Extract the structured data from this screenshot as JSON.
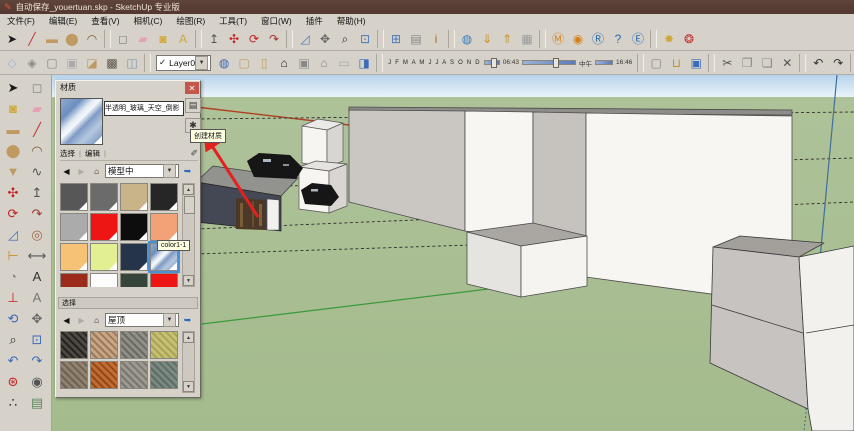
{
  "window": {
    "title": "自动保存_youertuan.skp - SketchUp 专业版"
  },
  "menu": {
    "items": [
      {
        "name": "file",
        "label": "文件(F)"
      },
      {
        "name": "edit",
        "label": "编辑(E)"
      },
      {
        "name": "view",
        "label": "查看(V)"
      },
      {
        "name": "camera",
        "label": "相机(C)"
      },
      {
        "name": "draw",
        "label": "绘图(R)"
      },
      {
        "name": "tools",
        "label": "工具(T)"
      },
      {
        "name": "window",
        "label": "窗口(W)"
      },
      {
        "name": "plugins",
        "label": "插件"
      },
      {
        "name": "help",
        "label": "帮助(H)"
      }
    ]
  },
  "toolbars": {
    "top": {
      "icons": [
        {
          "name": "select",
          "glyph": "➤",
          "color": "#1a1a1a"
        },
        {
          "name": "line",
          "glyph": "╱",
          "color": "#c03030"
        },
        {
          "name": "rectangle",
          "glyph": "▬",
          "color": "#bf9a63"
        },
        {
          "name": "circle",
          "glyph": "⬤",
          "color": "#bf9a63"
        },
        {
          "name": "arc",
          "glyph": "◠",
          "color": "#7a5a32"
        },
        {
          "sep": true
        },
        {
          "name": "make-component",
          "glyph": "◻",
          "color": "#8a8a8a"
        },
        {
          "name": "eraser",
          "glyph": "▰",
          "color": "#e8a0b6"
        },
        {
          "name": "paint-bucket",
          "glyph": "◙",
          "color": "#d0a83a"
        },
        {
          "name": "text",
          "glyph": "A",
          "color": "#caa83e"
        },
        {
          "sep": true
        },
        {
          "name": "push-pull",
          "glyph": "↥",
          "color": "#555555"
        },
        {
          "name": "move",
          "glyph": "✣",
          "color": "#c42222"
        },
        {
          "name": "rotate",
          "glyph": "⟳",
          "color": "#c42222"
        },
        {
          "name": "follow-me",
          "glyph": "↷",
          "color": "#a03030"
        },
        {
          "sep": true
        },
        {
          "name": "scale",
          "glyph": "◿",
          "color": "#4a7ab8"
        },
        {
          "name": "pan",
          "glyph": "✥",
          "color": "#666666"
        },
        {
          "name": "zoom",
          "glyph": "⌕",
          "color": "#333333"
        },
        {
          "name": "zoom-extents",
          "glyph": "⊡",
          "color": "#4a7ab8"
        },
        {
          "sep": true
        },
        {
          "name": "model-info",
          "glyph": "⊞",
          "color": "#4a7ab8"
        },
        {
          "name": "layers-window",
          "glyph": "▤",
          "color": "#8a8a8a"
        },
        {
          "name": "entity-info",
          "glyph": "i",
          "color": "#b06a2a"
        },
        {
          "sep": true
        },
        {
          "name": "google-earth",
          "glyph": "◍",
          "color": "#3a7abd"
        },
        {
          "name": "get-current-view",
          "glyph": "⇓",
          "color": "#c89020"
        },
        {
          "name": "place-model",
          "glyph": "⇑",
          "color": "#c89020"
        },
        {
          "name": "toggle-terrain",
          "glyph": "▦",
          "color": "#9a9a9a"
        },
        {
          "sep": true
        },
        {
          "name": "plugin-m",
          "glyph": "Ⓜ",
          "color": "#d88018"
        },
        {
          "name": "plugin-globe",
          "glyph": "◉",
          "color": "#d88018"
        },
        {
          "name": "plugin-r",
          "glyph": "Ⓡ",
          "color": "#2a6ab0"
        },
        {
          "name": "plugin-help",
          "glyph": "?",
          "color": "#2a6ab0"
        },
        {
          "name": "plugin-e",
          "glyph": "Ⓔ",
          "color": "#2a6ab0"
        },
        {
          "sep": true
        },
        {
          "name": "sun-tool",
          "glyph": "✸",
          "color": "#d0a83a"
        },
        {
          "name": "color-swirl",
          "glyph": "❂",
          "color": "#c03030"
        }
      ]
    },
    "second": {
      "style_icons": [
        {
          "name": "style-xray",
          "glyph": "◇",
          "color": "#9ab8cc"
        },
        {
          "name": "style-back-edges",
          "glyph": "◈",
          "color": "#888888"
        },
        {
          "name": "style-wireframe",
          "glyph": "▢",
          "color": "#888888"
        },
        {
          "name": "style-hidden-line",
          "glyph": "▣",
          "color": "#aaaaaa"
        },
        {
          "name": "style-shaded",
          "glyph": "◪",
          "color": "#bf9a63"
        },
        {
          "name": "style-shaded-textures",
          "glyph": "▩",
          "color": "#5a5248"
        },
        {
          "name": "style-monochrome",
          "glyph": "◫",
          "color": "#8898a8"
        }
      ],
      "layer": {
        "checkmark": "✓",
        "value": "Layer0"
      },
      "mid_icons": [
        {
          "name": "layer-manager",
          "glyph": "◍",
          "color": "#3a6ab8"
        },
        {
          "name": "plugin-carton",
          "glyph": "▢",
          "color": "#bf9a63"
        },
        {
          "name": "plugin-door",
          "glyph": "▯",
          "color": "#bf9a63"
        },
        {
          "name": "plugin-house-dark",
          "glyph": "⌂",
          "color": "#222222"
        },
        {
          "name": "plugin-box-white",
          "glyph": "▣",
          "color": "#888888"
        },
        {
          "name": "plugin-house-outline",
          "glyph": "⌂",
          "color": "#888888"
        },
        {
          "name": "plugin-panel",
          "glyph": "▭",
          "color": "#aaaaaa"
        },
        {
          "name": "solid-cube",
          "glyph": "◨",
          "color": "#3a6ab8"
        }
      ],
      "shadow": {
        "months": "J F M A M J J A S O N D",
        "start": "06:43",
        "noon": "中午",
        "end": "16:46"
      },
      "file_icons": [
        {
          "name": "new",
          "glyph": "▢",
          "color": "#888888"
        },
        {
          "name": "open",
          "glyph": "⊔",
          "color": "#c89020"
        },
        {
          "name": "save",
          "glyph": "▣",
          "color": "#3a6ab8"
        },
        {
          "sep": true
        },
        {
          "name": "cut",
          "glyph": "✂",
          "color": "#555555"
        },
        {
          "name": "copy",
          "glyph": "❐",
          "color": "#888888"
        },
        {
          "name": "paste",
          "glyph": "❏",
          "color": "#888888"
        },
        {
          "name": "delete",
          "glyph": "✕",
          "color": "#555555"
        },
        {
          "sep": true
        },
        {
          "name": "undo",
          "glyph": "↶",
          "color": "#333333"
        },
        {
          "name": "redo",
          "glyph": "↷",
          "color": "#333333"
        },
        {
          "sep": true
        },
        {
          "name": "print",
          "glyph": "⎙",
          "color": "#555555"
        }
      ]
    }
  },
  "palette": {
    "tools": [
      {
        "name": "select",
        "glyph": "➤",
        "color": "#1a1a1a"
      },
      {
        "name": "make-component",
        "glyph": "◻",
        "color": "#888888"
      },
      {
        "name": "paint-bucket",
        "glyph": "◙",
        "color": "#d0a83a"
      },
      {
        "name": "eraser",
        "glyph": "▰",
        "color": "#e8a0b6"
      },
      {
        "name": "rectangle",
        "glyph": "▬",
        "color": "#bf9a63"
      },
      {
        "name": "line",
        "glyph": "╱",
        "color": "#c03030"
      },
      {
        "name": "circle",
        "glyph": "⬤",
        "color": "#bf9a63"
      },
      {
        "name": "arc",
        "glyph": "◠",
        "color": "#7a5a32"
      },
      {
        "name": "polygon",
        "glyph": "▼",
        "color": "#bf9a63"
      },
      {
        "name": "freehand",
        "glyph": "∿",
        "color": "#555555"
      },
      {
        "name": "move",
        "glyph": "✣",
        "color": "#c42222"
      },
      {
        "name": "push-pull",
        "glyph": "↥",
        "color": "#555555"
      },
      {
        "name": "rotate",
        "glyph": "⟳",
        "color": "#c42222"
      },
      {
        "name": "follow-me",
        "glyph": "↷",
        "color": "#a03030"
      },
      {
        "name": "scale",
        "glyph": "◿",
        "color": "#4a7ab8"
      },
      {
        "name": "offset",
        "glyph": "◎",
        "color": "#a06a4a"
      },
      {
        "name": "tape-measure",
        "glyph": "⊢",
        "color": "#c89020"
      },
      {
        "name": "dimension",
        "glyph": "⟷",
        "color": "#555555"
      },
      {
        "name": "protractor",
        "glyph": "◔",
        "color": "#888888"
      },
      {
        "name": "text",
        "glyph": "A",
        "color": "#333333"
      },
      {
        "name": "axes",
        "glyph": "⊥",
        "color": "#c42222"
      },
      {
        "name": "3d-text",
        "glyph": "A",
        "color": "#777777"
      },
      {
        "name": "orbit",
        "glyph": "⟲",
        "color": "#3a6ab8"
      },
      {
        "name": "pan",
        "glyph": "✥",
        "color": "#666666"
      },
      {
        "name": "zoom",
        "glyph": "⌕",
        "color": "#333333"
      },
      {
        "name": "zoom-window",
        "glyph": "⊡",
        "color": "#3a6ab8"
      },
      {
        "name": "previous-view",
        "glyph": "↶",
        "color": "#3a6ab8"
      },
      {
        "name": "next-view",
        "glyph": "↷",
        "color": "#3a6ab8"
      },
      {
        "name": "position-camera",
        "glyph": "⊛",
        "color": "#c42222"
      },
      {
        "name": "look-around",
        "glyph": "◉",
        "color": "#555555"
      },
      {
        "name": "walk",
        "glyph": "∴",
        "color": "#222222"
      },
      {
        "name": "section-plane",
        "glyph": "▤",
        "color": "#5a8a5a"
      }
    ]
  },
  "materials_panel": {
    "title": "材质",
    "close_glyph": "✕",
    "material_name": "半透明_玻璃_天空_倒影",
    "pane_toggle_glyph": "▤",
    "create_material_glyph": "✱",
    "sample_paint_glyph": "✐",
    "tabs": [
      "选择",
      "编辑"
    ],
    "nav": {
      "back": "◀",
      "forward": "▶",
      "home": "⌂",
      "collection": "模型中",
      "detail": "➥"
    },
    "selected_swatch_label": "color1-1",
    "tooltip_create": "创建材质",
    "swatches": [
      {
        "name": "dark-gray",
        "color": "#575757"
      },
      {
        "name": "gray",
        "color": "#6b6b6b"
      },
      {
        "name": "tan",
        "color": "#c8b488"
      },
      {
        "name": "near-black",
        "color": "#262626"
      },
      {
        "name": "light-gray",
        "color": "#ababab"
      },
      {
        "name": "red",
        "color": "#ee1515"
      },
      {
        "name": "black",
        "color": "#0d0d0d"
      },
      {
        "name": "salmon",
        "color": "#f2a276"
      },
      {
        "name": "light-orange",
        "color": "#f6c276"
      },
      {
        "name": "yellow-green",
        "color": "#e2ef92"
      },
      {
        "name": "dark-navy",
        "color": "#253448"
      },
      {
        "name": "sky-texture",
        "color": "sky",
        "selected": true
      },
      {
        "name": "dark-red",
        "color": "#9b2c1c"
      },
      {
        "name": "white",
        "color": "#fcfcfc"
      },
      {
        "name": "dark-green",
        "color": "#36453a"
      },
      {
        "name": "red-2",
        "color": "#ee1515"
      }
    ],
    "secondary": {
      "header_label": "选择",
      "nav": {
        "back": "◀",
        "forward": "▶",
        "home": "⌂",
        "collection": "屋顶",
        "detail": "➥"
      },
      "textures": [
        {
          "name": "shingles-dark",
          "c1": "#4e4843",
          "c2": "#262220"
        },
        {
          "name": "stone-tan",
          "c1": "#c9a584",
          "c2": "#9a7a5c"
        },
        {
          "name": "slate-gray",
          "c1": "#8f8f88",
          "c2": "#6a6a62"
        },
        {
          "name": "thatch-yellow",
          "c1": "#c5c072",
          "c2": "#a8a358"
        },
        {
          "name": "gravel-brown",
          "c1": "#90826f",
          "c2": "#6e6253"
        },
        {
          "name": "tiles-orange",
          "c1": "#c46c30",
          "c2": "#8f4a1e"
        },
        {
          "name": "stone-gray",
          "c1": "#9c9a90",
          "c2": "#7a786e"
        },
        {
          "name": "slate-blue",
          "c1": "#7a8a82",
          "c2": "#5c6c66"
        }
      ]
    }
  },
  "viewport": {
    "colors": {
      "sky": "#bcd6ec",
      "ground": "#a9bf93",
      "red_axis": "#b04020",
      "green_axis": "#3a9a3a",
      "blue_axis": "#3d6f9e",
      "annotation_arrow": "#e42020",
      "face_white": "#f7f6f2",
      "face_gray": "#cac7c3",
      "slab_dark": "#434854"
    }
  }
}
